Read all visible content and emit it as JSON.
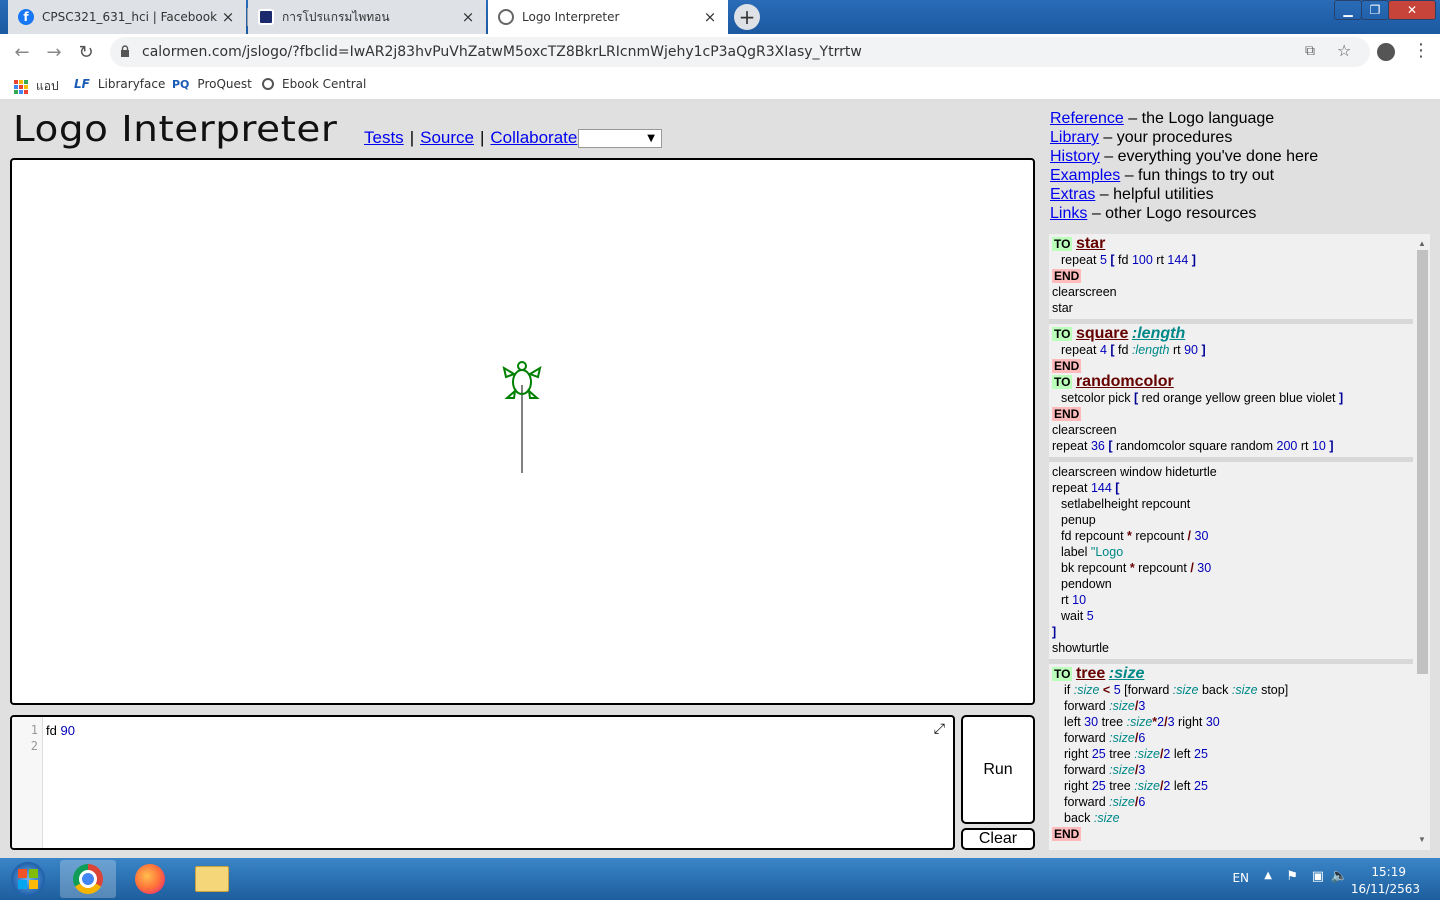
{
  "browser": {
    "tabs": [
      {
        "title": "CPSC321_631_hci | Facebook",
        "icon": "facebook-icon",
        "active": false
      },
      {
        "title": "การโปรแกรมไพทอน",
        "icon": "film-icon",
        "active": false
      },
      {
        "title": "Logo Interpreter",
        "icon": "page-icon",
        "active": true
      }
    ],
    "close_glyph": "×",
    "new_tab_glyph": "+",
    "url": "calormen.com/jslogo/?fbclid=IwAR2j83hvPuVhZatwM5oxcTZ8BkrLRIcnmWjehy1cP3aQgR3XIasy_Ytrrtw",
    "bookmarks": [
      {
        "label": "แอป",
        "icon": "apps-grid-icon"
      },
      {
        "label": "Libraryface",
        "icon": "libraryface-icon"
      },
      {
        "label": "ProQuest",
        "icon": "proquest-icon",
        "icon_text": "PQ"
      },
      {
        "label": "Ebook Central",
        "icon": "globe-icon"
      }
    ]
  },
  "page": {
    "title": "Logo Interpreter",
    "links": {
      "tests": "Tests",
      "source": "Source",
      "collaborate": "Collaborate",
      "separator": "|"
    },
    "select_value": ""
  },
  "editor": {
    "line_numbers": [
      "1",
      "2"
    ],
    "code": {
      "cmd": "fd",
      "arg": "90"
    },
    "expand_glyph": "⤢"
  },
  "buttons": {
    "run": "Run",
    "clear": "Clear"
  },
  "rightnav": [
    {
      "link": "Reference",
      "desc": "– the Logo language"
    },
    {
      "link": "Library",
      "desc": "– your procedures"
    },
    {
      "link": "History",
      "desc": "– everything you've done here"
    },
    {
      "link": "Examples",
      "desc": "– fun things to try out"
    },
    {
      "link": "Extras",
      "desc": "– helpful utilities"
    },
    {
      "link": "Links",
      "desc": "– other Logo resources"
    }
  ],
  "library": {
    "to": "TO",
    "end": "END",
    "star": {
      "name": "star",
      "body": {
        "a": "repeat",
        "n1": "5",
        "b1": "[",
        "c": "fd",
        "n2": "100",
        "d": "rt",
        "n3": "144",
        "b2": "]"
      }
    },
    "clearscreen": "clearscreen",
    "star_call": "star",
    "square": {
      "name": "square",
      "param": ":length",
      "body": {
        "a": "repeat",
        "n1": "4",
        "b1": "[",
        "c": "fd",
        "v": ":length",
        "d": "rt",
        "n2": "90",
        "b2": "]"
      }
    },
    "randomcolor": {
      "name": "randomcolor",
      "body": {
        "a": "setcolor pick",
        "b1": "[",
        "list": "red orange yellow green blue violet",
        "b2": "]"
      }
    },
    "repeat36": {
      "a": "repeat",
      "n1": "36",
      "b1": "[",
      "c": "randomcolor square random",
      "n2": "200",
      "d": "rt",
      "n3": "10",
      "b2": "]"
    },
    "spiral": {
      "l1": "clearscreen window hideturtle",
      "l2a": "repeat",
      "l2n": "144",
      "l2b": "[",
      "l3": "setlabelheight repcount",
      "l4": "penup",
      "l5a": "fd repcount",
      "l5op1": "*",
      "l5b": "repcount",
      "l5op2": "/",
      "l5n": "30",
      "l6a": "label",
      "l6s": "\"Logo",
      "l7a": "bk repcount",
      "l7op1": "*",
      "l7b": "repcount",
      "l7op2": "/",
      "l7n": "30",
      "l8": "pendown",
      "l9a": "rt",
      "l9n": "10",
      "l10a": "wait",
      "l10n": "5",
      "l11": "]",
      "l12": "showturtle"
    },
    "tree": {
      "name": "tree",
      "param": ":size",
      "if": {
        "a": "if",
        "v1": ":size",
        "op": "<",
        "n": "5",
        "b1": "[forward",
        "v2": ":size",
        "c": "back",
        "v3": ":size",
        "d": "stop]"
      },
      "f1": {
        "a": "forward",
        "v": ":size",
        "op": "/",
        "n": "3"
      },
      "l1": {
        "a": "left",
        "n1": "30",
        "b": "tree",
        "v": ":size",
        "op1": "*",
        "n2": "2",
        "op2": "/",
        "n3": "3",
        "c": "right",
        "n4": "30"
      },
      "f2": {
        "a": "forward",
        "v": ":size",
        "op": "/",
        "n": "6"
      },
      "r1": {
        "a": "right",
        "n1": "25",
        "b": "tree",
        "v": ":size",
        "op": "/",
        "n2": "2",
        "c": "left",
        "n3": "25"
      },
      "f3": {
        "a": "forward",
        "v": ":size",
        "op": "/",
        "n": "3"
      },
      "r2": {
        "a": "right",
        "n1": "25",
        "b": "tree",
        "v": ":size",
        "op": "/",
        "n2": "2",
        "c": "left",
        "n3": "25"
      },
      "f4": {
        "a": "forward",
        "v": ":size",
        "op": "/",
        "n": "6"
      },
      "back": {
        "a": "back",
        "v": ":size"
      }
    }
  },
  "taskbar": {
    "items": [
      "windows-start-icon",
      "chrome-icon",
      "firefox-icon",
      "file-explorer-icon"
    ],
    "lang": "EN",
    "time": "15:19",
    "date": "16/11/2563"
  },
  "colors": {
    "accent_link": "#0000ee",
    "to_bg": "#bbffbb",
    "end_bg": "#ffbbbb",
    "turtle": "#008000"
  }
}
